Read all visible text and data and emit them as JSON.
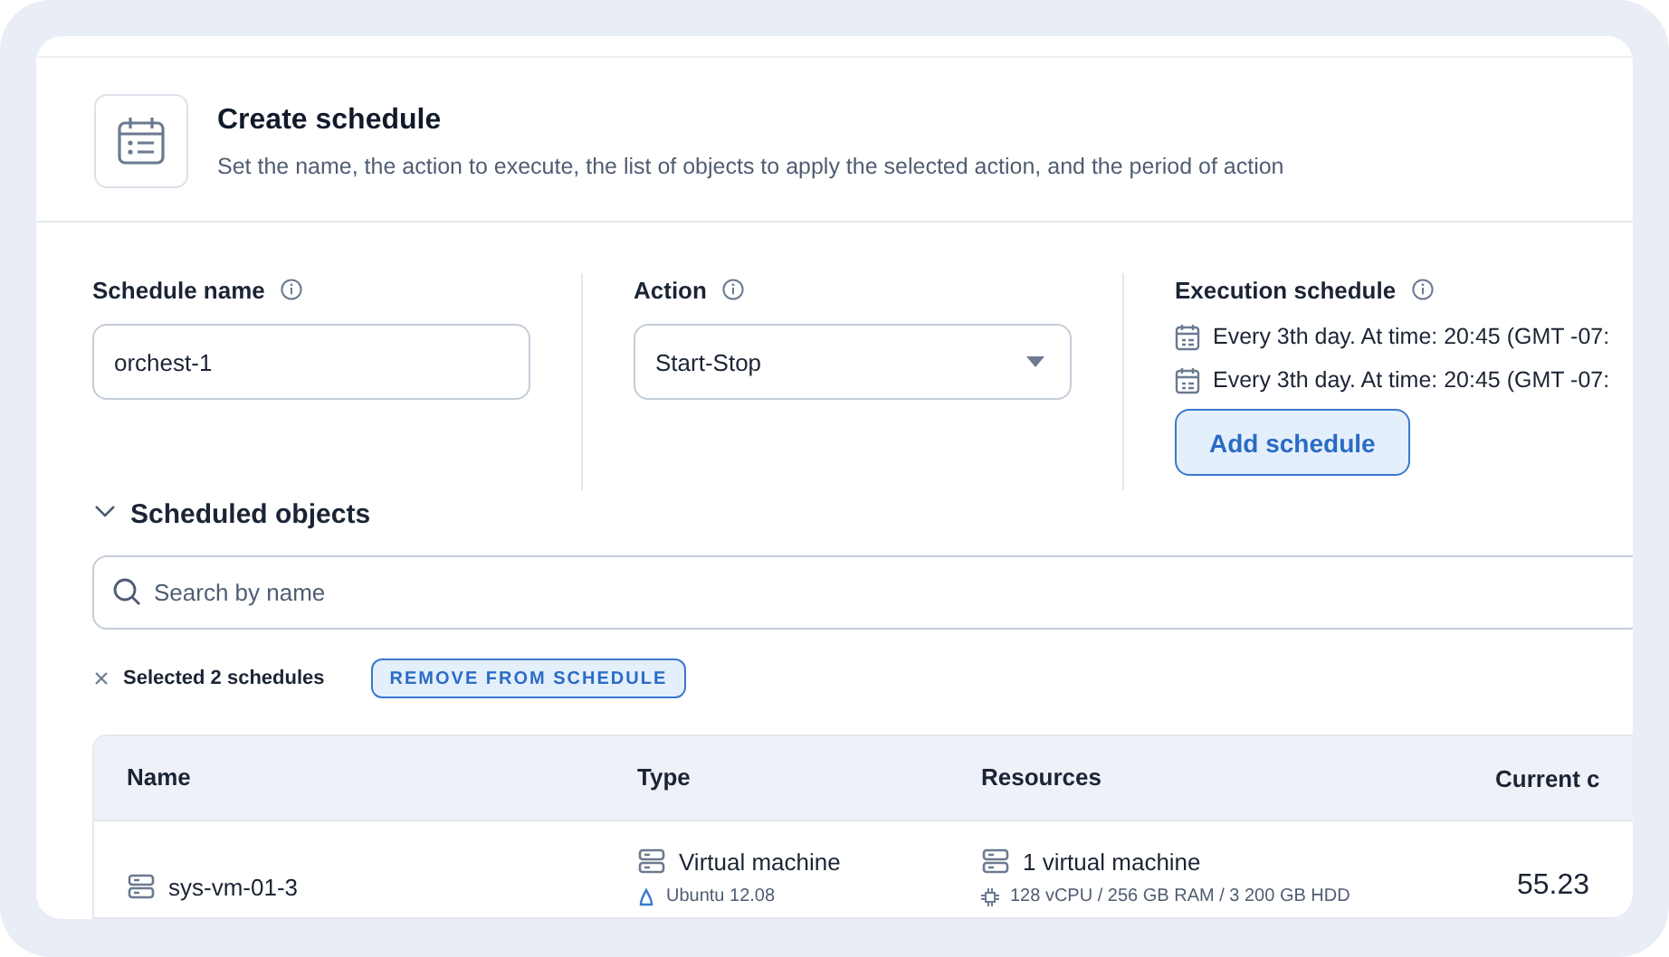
{
  "header": {
    "title": "Create schedule",
    "subtitle": "Set the name, the action to execute, the list of objects to apply the selected action, and the period of action"
  },
  "fields": [
    {
      "kind": "text",
      "label": "Schedule name",
      "value": "orchest-1"
    },
    {
      "kind": "select",
      "label": "Action",
      "value": "Start-Stop"
    }
  ],
  "execution_schedule": {
    "label": "Execution schedule",
    "entries": [
      "Every 3th day. At time: 20:45 (GMT -07:",
      "Every 3th day. At time: 20:45 (GMT -07:"
    ],
    "add_button": "Add schedule"
  },
  "scheduled_objects": {
    "title": "Scheduled objects",
    "expanded": true,
    "search": {
      "placeholder": "Search by name"
    },
    "selection": {
      "text": "Selected 2 schedules",
      "action": "REMOVE FROM SCHEDULE"
    }
  },
  "table": {
    "columns": [
      "Name",
      "Type",
      "Resources",
      "Current c"
    ],
    "rows": [
      {
        "name": "sys-vm-01-3",
        "type": "Virtual machine",
        "os": "Ubuntu 12.08",
        "resources": "1 virtual machine",
        "specs": "128 vCPU / 256 GB RAM / 3 200 GB HDD",
        "cost": "55.23"
      }
    ]
  }
}
